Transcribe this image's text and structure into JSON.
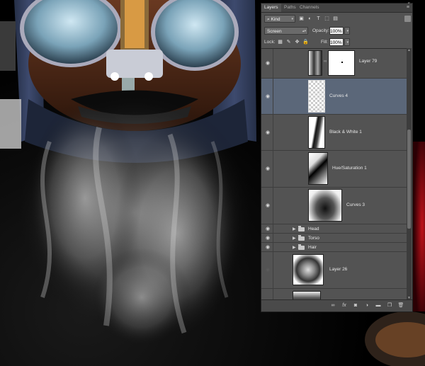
{
  "panel": {
    "tabs": [
      "Layers",
      "Paths",
      "Channels"
    ],
    "filter_kind": "Kind",
    "blend_mode": "Screen",
    "opacity_label": "Opacity:",
    "opacity_value": "100%",
    "lock_label": "Lock:",
    "fill_label": "Fill:",
    "fill_value": "100%",
    "layers": [
      {
        "name": "Layer 79",
        "type": "masked",
        "visible": true,
        "selected": false
      },
      {
        "name": "Curves 4",
        "type": "adjustment",
        "visible": true,
        "selected": true
      },
      {
        "name": "Black & White 1",
        "type": "adjustment",
        "visible": true,
        "selected": false
      },
      {
        "name": "Hue/Saturation 1",
        "type": "adjustment",
        "visible": true,
        "selected": false
      },
      {
        "name": "Curves 3",
        "type": "adjustment",
        "visible": true,
        "selected": false
      },
      {
        "name": "Head",
        "type": "group",
        "visible": true,
        "selected": false
      },
      {
        "name": "Torso",
        "type": "group",
        "visible": true,
        "selected": false
      },
      {
        "name": "Hair",
        "type": "group",
        "visible": true,
        "selected": false
      },
      {
        "name": "Layer 26",
        "type": "pixel",
        "visible": false,
        "selected": false
      }
    ]
  },
  "colors": {
    "panel_bg": "#535353",
    "selected_row": "#5b6779",
    "input_bg": "#f2f2f2"
  },
  "icons": {
    "filter_icons": [
      "image-filter-icon",
      "adjustment-filter-icon",
      "type-filter-icon",
      "shape-filter-icon",
      "smart-object-filter-icon",
      "toggle-filter-icon"
    ],
    "lock_icons": [
      "lock-transparent-icon",
      "lock-pixels-icon",
      "lock-position-icon",
      "lock-all-icon"
    ],
    "footer_icons": [
      "link-layers-icon",
      "fx-icon",
      "add-mask-icon",
      "new-adjustment-icon",
      "new-group-icon",
      "new-layer-icon",
      "trash-icon"
    ]
  }
}
